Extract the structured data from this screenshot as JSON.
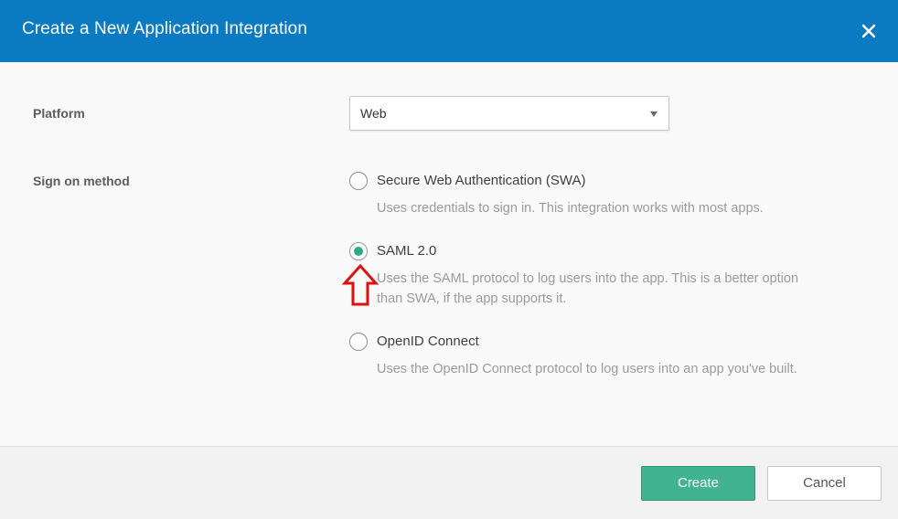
{
  "dialog": {
    "title": "Create a New Application Integration",
    "close_icon": "close-icon",
    "header_color": "#0a7bc2"
  },
  "platform": {
    "label": "Platform",
    "selected": "Web"
  },
  "sign_on": {
    "label": "Sign on method",
    "options": [
      {
        "label": "Secure Web Authentication (SWA)",
        "description": "Uses credentials to sign in. This integration works with most apps.",
        "checked": false
      },
      {
        "label": "SAML 2.0",
        "description_line1": "Uses the SAML protocol to log users into the app. This is a better option",
        "description_line2": "than SWA, if the app supports it.",
        "checked": true
      },
      {
        "label": "OpenID Connect",
        "description": "Uses the OpenID Connect protocol to log users into an app you've built.",
        "checked": false
      }
    ],
    "selected_color": "#2dab85"
  },
  "annotation": {
    "icon": "red-up-arrow-icon",
    "color": "#e01010"
  },
  "footer": {
    "create_label": "Create",
    "cancel_label": "Cancel",
    "create_color": "#41b38e"
  }
}
